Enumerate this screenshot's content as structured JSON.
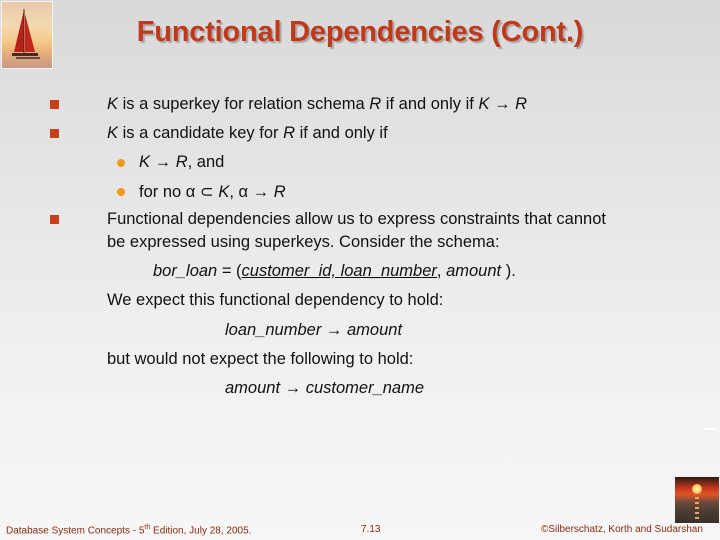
{
  "slide": {
    "title": "Functional Dependencies (Cont.)",
    "bullets": [
      {
        "level": 1,
        "parts": [
          {
            "text": "K",
            "italic": true
          },
          {
            "text": " is a superkey for relation schema "
          },
          {
            "text": "R",
            "italic": true
          },
          {
            "text": " if and only if "
          },
          {
            "text": "K",
            "italic": true
          },
          {
            "text": " → "
          },
          {
            "text": "R",
            "italic": true
          }
        ]
      },
      {
        "level": 1,
        "parts": [
          {
            "text": "K",
            "italic": true
          },
          {
            "text": " is a candidate key for "
          },
          {
            "text": "R",
            "italic": true
          },
          {
            "text": " if and only if"
          }
        ]
      },
      {
        "level": 2,
        "parts": [
          {
            "text": "K",
            "italic": true
          },
          {
            "text": " → "
          },
          {
            "text": "R",
            "italic": true
          },
          {
            "text": ", and"
          }
        ]
      },
      {
        "level": 2,
        "parts": [
          {
            "text": "for no α ⊂ "
          },
          {
            "text": "K",
            "italic": true
          },
          {
            "text": ", α → "
          },
          {
            "text": "R",
            "italic": true
          }
        ]
      },
      {
        "level": 1,
        "lines": [
          "Functional dependencies allow us to express constraints that cannot",
          "be expressed using superkeys.  Consider the schema:"
        ]
      }
    ],
    "schema_line": [
      {
        "text": "bor_loan",
        "italic": true
      },
      {
        "text": " = ("
      },
      {
        "text": "customer_id, loan_number",
        "italic": true,
        "underline": true
      },
      {
        "text": ", "
      },
      {
        "text": "amount",
        "italic": true
      },
      {
        "text": " )."
      }
    ],
    "expect_hold": "We expect this functional dependency to hold:",
    "fd_hold": {
      "left": "loan_number",
      "arrow": " → ",
      "right": "amount"
    },
    "expect_not_hold": "but would not expect the following to hold:",
    "fd_not_hold": {
      "left": "amount",
      "arrow": " → ",
      "right": "customer_name"
    }
  },
  "footer": {
    "left_prefix": "Database System Concepts - 5",
    "left_sup": "th",
    "left_suffix": " Edition, July 28, 2005.",
    "page": "7.13",
    "right": "©Silberschatz, Korth and Sudarshan"
  },
  "colors": {
    "title": "#c0391b",
    "bullet_square": "#c8401a",
    "bullet_dot": "#f39a1e",
    "footer_text": "#8a2a10"
  }
}
